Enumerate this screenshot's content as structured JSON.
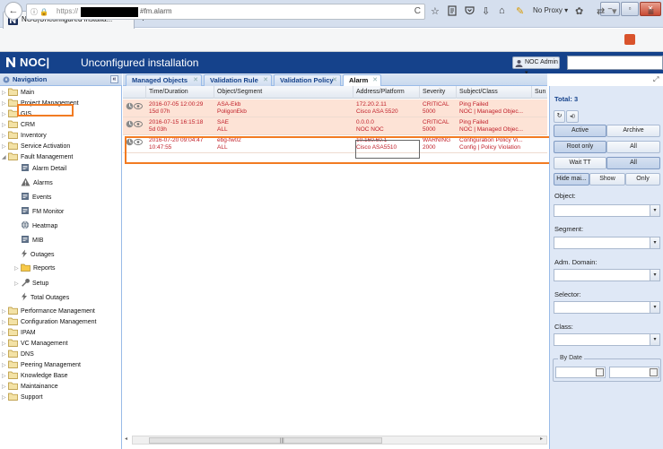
{
  "browser": {
    "tab_title": "NOC|Unconfigured installa...",
    "tab_close": "×",
    "new_tab": "+",
    "url_lead": "ⓘ 🔒",
    "url_scheme": "https://",
    "url_suffix": "#fm.alarm",
    "reload": "C",
    "proxy_label": "No Proxy ▾",
    "minimize": "–",
    "maximize": "▫",
    "close": "✕"
  },
  "app": {
    "brand": "NOC|",
    "title": "Unconfigured installation",
    "user_menu": "NOC Admin ▾"
  },
  "navigation": {
    "title": "Navigation",
    "collapse": "«",
    "items": [
      {
        "label": "Main",
        "level": 0,
        "type": "folder"
      },
      {
        "label": "Project Management",
        "level": 0,
        "type": "folder"
      },
      {
        "label": "GIS",
        "level": 0,
        "type": "folder"
      },
      {
        "label": "CRM",
        "level": 0,
        "type": "folder"
      },
      {
        "label": "Inventory",
        "level": 0,
        "type": "folder"
      },
      {
        "label": "Service Activation",
        "level": 0,
        "type": "folder"
      },
      {
        "label": "Fault Management",
        "level": 0,
        "type": "folder-open"
      },
      {
        "label": "Alarm Detail",
        "level": 1,
        "type": "doc"
      },
      {
        "label": "Alarms",
        "level": 1,
        "type": "warning"
      },
      {
        "label": "Events",
        "level": 1,
        "type": "doc"
      },
      {
        "label": "FM Monitor",
        "level": 1,
        "type": "doc"
      },
      {
        "label": "Heatmap",
        "level": 1,
        "type": "globe"
      },
      {
        "label": "MIB",
        "level": 1,
        "type": "doc"
      },
      {
        "label": "Outages",
        "level": 1,
        "type": "bolt"
      },
      {
        "label": "Reports",
        "level": 1,
        "type": "folder-y"
      },
      {
        "label": "Setup",
        "level": 1,
        "type": "wrench"
      },
      {
        "label": "Total Outages",
        "level": 1,
        "type": "bolt"
      },
      {
        "label": "Performance Management",
        "level": 0,
        "type": "folder"
      },
      {
        "label": "Configuration Management",
        "level": 0,
        "type": "folder"
      },
      {
        "label": "IPAM",
        "level": 0,
        "type": "folder"
      },
      {
        "label": "VC Management",
        "level": 0,
        "type": "folder"
      },
      {
        "label": "DNS",
        "level": 0,
        "type": "folder"
      },
      {
        "label": "Peering Management",
        "level": 0,
        "type": "folder"
      },
      {
        "label": "Knowledge Base",
        "level": 0,
        "type": "folder"
      },
      {
        "label": "Maintainance",
        "level": 0,
        "type": "folder"
      },
      {
        "label": "Support",
        "level": 0,
        "type": "folder"
      }
    ]
  },
  "tabs": [
    {
      "label": "Managed Objects",
      "close": "✕"
    },
    {
      "label": "Validation Rule",
      "close": "✕"
    },
    {
      "label": "Validation Policy",
      "close": "✕"
    },
    {
      "label": "Alarm",
      "close": "✕"
    }
  ],
  "grid": {
    "columns": [
      "Time/Duration",
      "Object/Segment",
      "Address/Platform",
      "Severity",
      "Subject/Class",
      "Sun"
    ],
    "rows": [
      {
        "status": "critical",
        "time": "2016-07-05 12:00:29",
        "duration": "15d 07h",
        "object": "ASA-Ekb",
        "segment": "PoligonEkb",
        "address": "172.20.2.11",
        "platform": "Cisco ASA 5520",
        "severity": "CRITICAL",
        "severity_num": "5000",
        "subject": "Ping Failed",
        "class": "NOC | Managed Objec..."
      },
      {
        "status": "critical",
        "time": "2016-07-15 16:15:18",
        "duration": "5d 03h",
        "object": "SAE",
        "segment": "ALL",
        "address": "0.0.0.0",
        "platform": "NOC NOC",
        "severity": "CRITICAL",
        "severity_num": "5000",
        "subject": "Ping Failed",
        "class": "NOC | Managed Objec..."
      },
      {
        "status": "warning",
        "time": "2016-07-20 09:04:47",
        "duration": "10:47:55",
        "object": "ebg-fw02",
        "segment": "ALL",
        "address": "10.160.60.1",
        "platform": "Cisco ASA5510",
        "severity": "WARNING",
        "severity_num": "2000",
        "subject": "Configuration Policy Vi...",
        "class": "Config | Policy Violation"
      }
    ],
    "scroll_grip": "|||"
  },
  "filter": {
    "total": "Total: 3",
    "refresh_icon": "↻",
    "sound_icon": "◂))",
    "active": "Active",
    "archive": "Archive",
    "root_only": "Root only",
    "all1": "All",
    "wait_tt": "Wait TT",
    "all2": "All",
    "hide_main": "Hide mai...",
    "show": "Show",
    "only": "Only",
    "object_label": "Object:",
    "segment_label": "Segment:",
    "adm_domain_label": "Adm. Domain:",
    "selector_label": "Selector:",
    "class_label": "Class:",
    "by_date": "By Date",
    "arrow": "▾"
  }
}
